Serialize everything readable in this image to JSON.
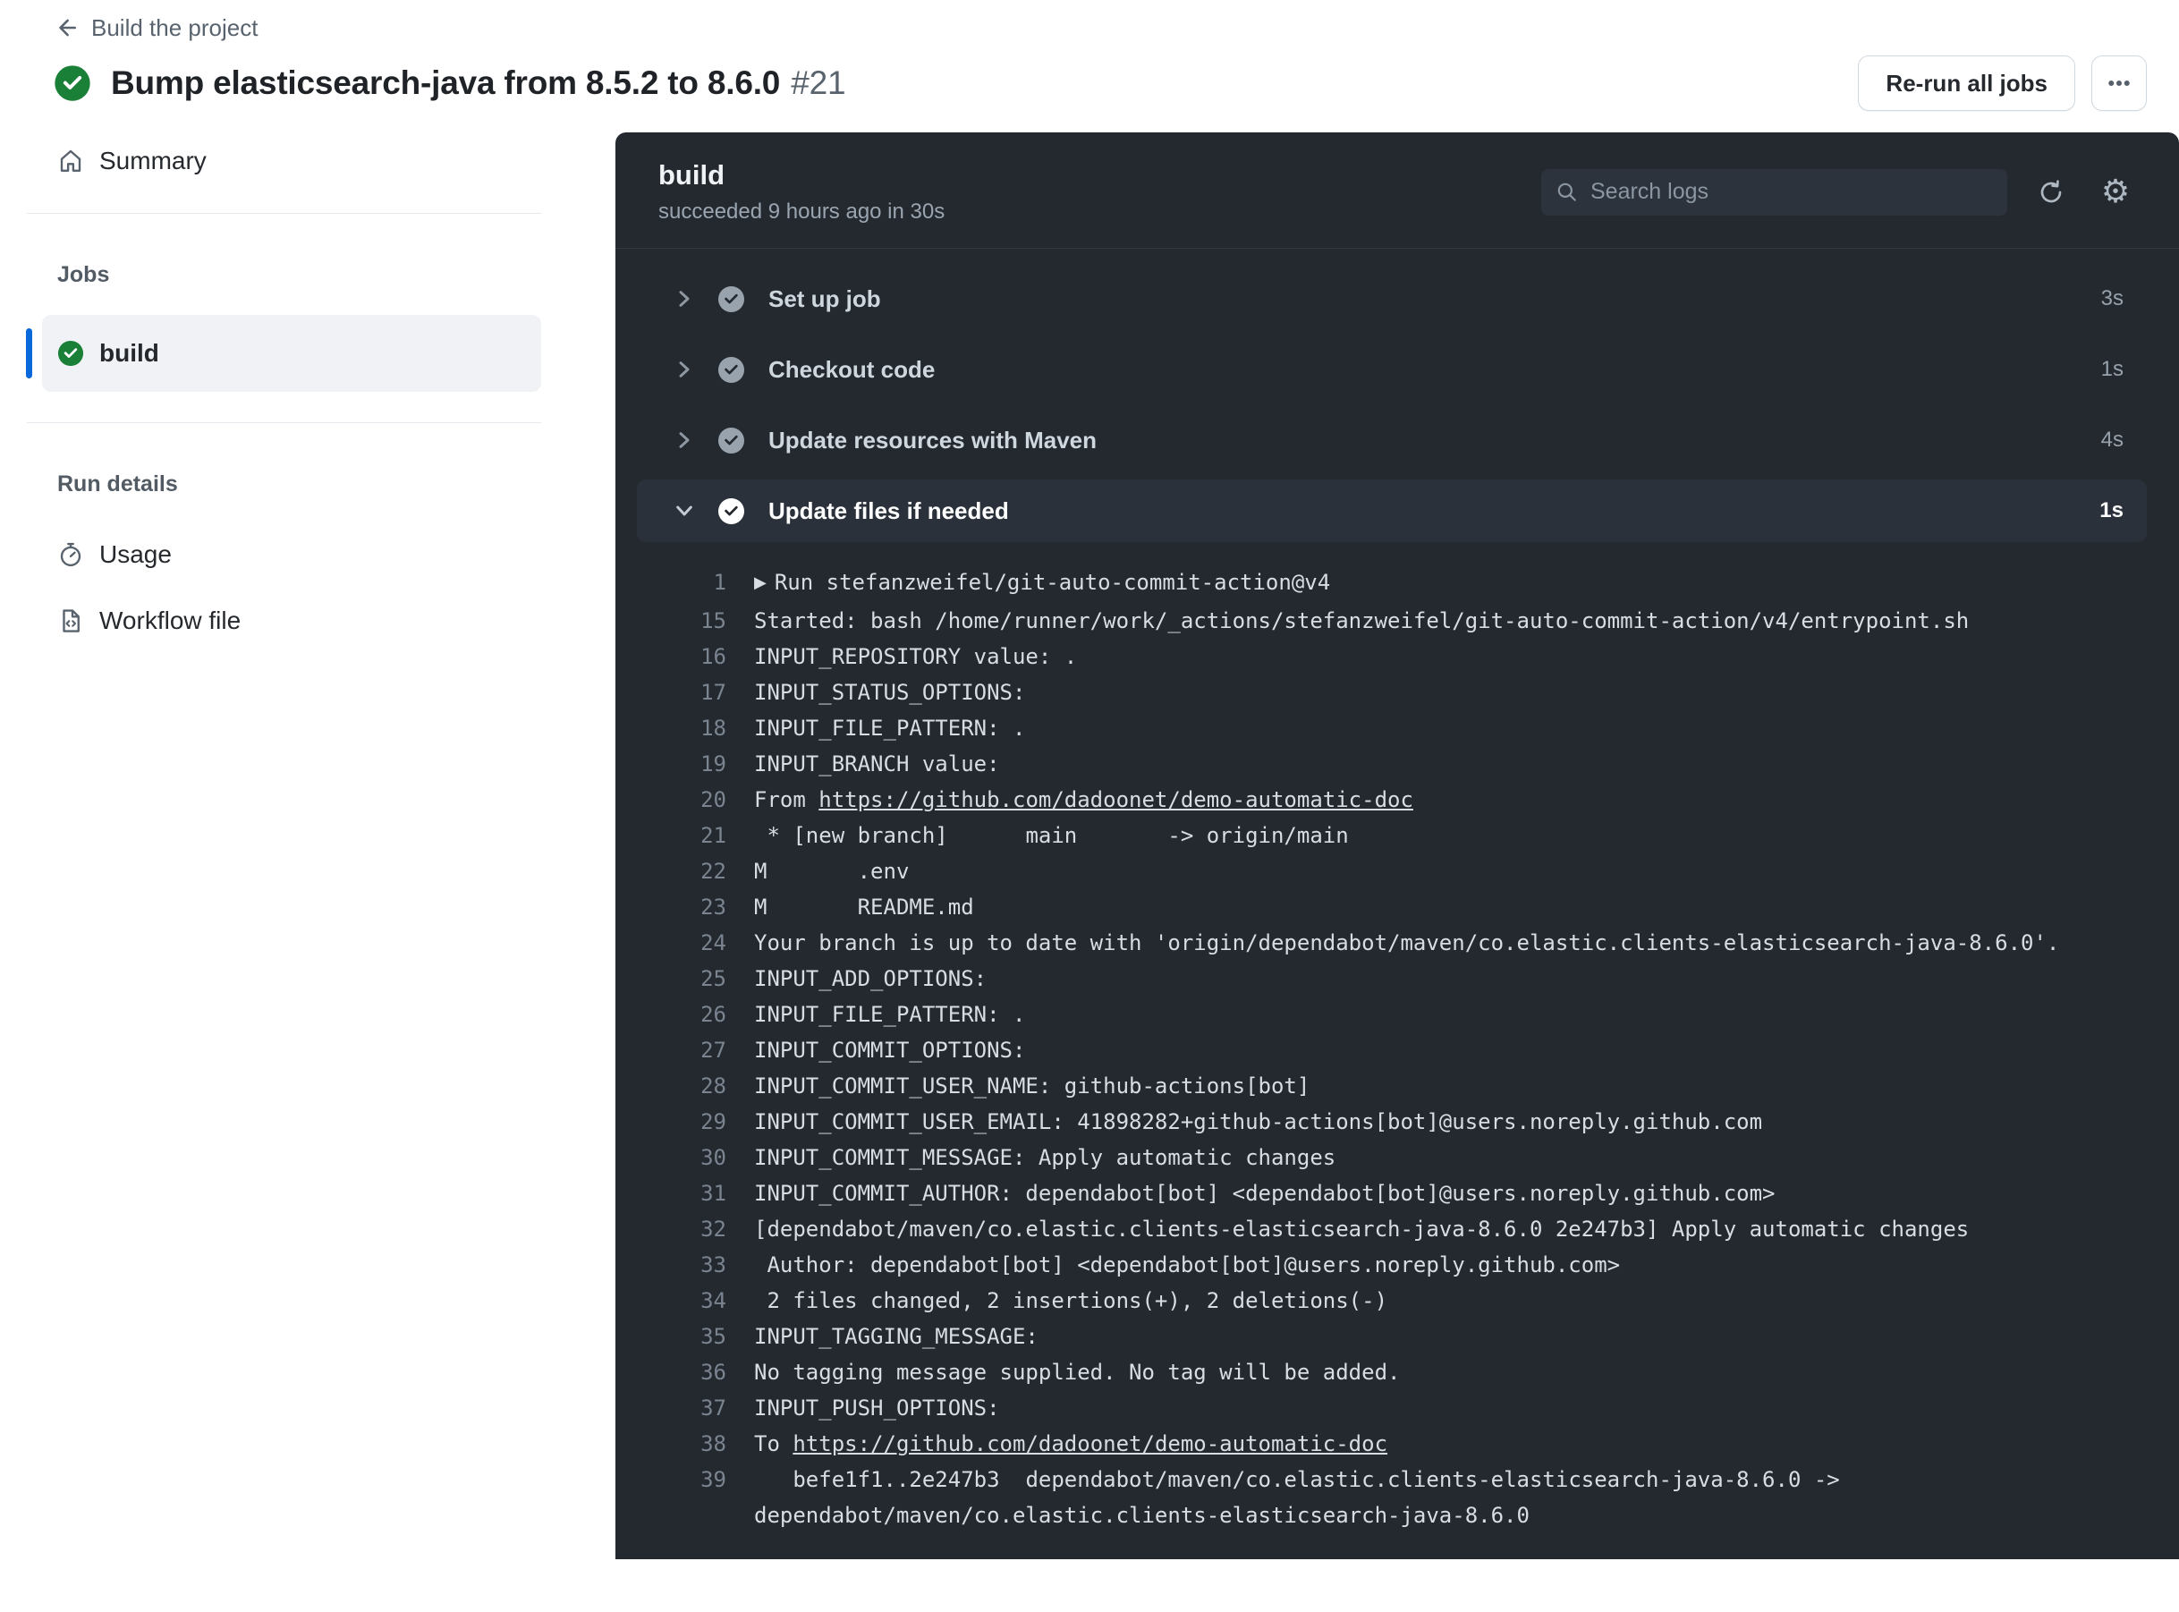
{
  "page": {
    "breadcrumb": "Build the project",
    "title": "Bump elasticsearch-java from 8.5.2 to 8.6.0",
    "run_number": "#21",
    "rerun_button": "Re-run all jobs",
    "kebab_menu": "more-options"
  },
  "sidebar": {
    "summary_label": "Summary",
    "jobs_heading": "Jobs",
    "job_name": "build",
    "run_details_heading": "Run details",
    "usage_label": "Usage",
    "workflow_file_label": "Workflow file"
  },
  "panel": {
    "job_name": "build",
    "status_line": "succeeded 9 hours ago in 30s",
    "search_placeholder": "Search logs",
    "steps": [
      {
        "label": "Set up job",
        "duration": "3s",
        "expanded": false
      },
      {
        "label": "Checkout code",
        "duration": "1s",
        "expanded": false
      },
      {
        "label": "Update resources with Maven",
        "duration": "4s",
        "expanded": false
      },
      {
        "label": "Update files if needed",
        "duration": "1s",
        "expanded": true
      }
    ],
    "log_lines": [
      {
        "n": "1",
        "prefix": "▶",
        "text": "Run stefanzweifel/git-auto-commit-action@v4"
      },
      {
        "n": "15",
        "text": "Started: bash /home/runner/work/_actions/stefanzweifel/git-auto-commit-action/v4/entrypoint.sh"
      },
      {
        "n": "16",
        "text": "INPUT_REPOSITORY value: ."
      },
      {
        "n": "17",
        "text": "INPUT_STATUS_OPTIONS:"
      },
      {
        "n": "18",
        "text": "INPUT_FILE_PATTERN: ."
      },
      {
        "n": "19",
        "text": "INPUT_BRANCH value:"
      },
      {
        "n": "20",
        "pre": "From ",
        "link": "https://github.com/dadoonet/demo-automatic-doc",
        "post": ""
      },
      {
        "n": "21",
        "text": " * [new branch]      main       -> origin/main"
      },
      {
        "n": "22",
        "text": "M       .env"
      },
      {
        "n": "23",
        "text": "M       README.md"
      },
      {
        "n": "24",
        "text": "Your branch is up to date with 'origin/dependabot/maven/co.elastic.clients-elasticsearch-java-8.6.0'."
      },
      {
        "n": "25",
        "text": "INPUT_ADD_OPTIONS:"
      },
      {
        "n": "26",
        "text": "INPUT_FILE_PATTERN: ."
      },
      {
        "n": "27",
        "text": "INPUT_COMMIT_OPTIONS:"
      },
      {
        "n": "28",
        "text": "INPUT_COMMIT_USER_NAME: github-actions[bot]"
      },
      {
        "n": "29",
        "text": "INPUT_COMMIT_USER_EMAIL: 41898282+github-actions[bot]@users.noreply.github.com"
      },
      {
        "n": "30",
        "text": "INPUT_COMMIT_MESSAGE: Apply automatic changes"
      },
      {
        "n": "31",
        "text": "INPUT_COMMIT_AUTHOR: dependabot[bot] <dependabot[bot]@users.noreply.github.com>"
      },
      {
        "n": "32",
        "text": "[dependabot/maven/co.elastic.clients-elasticsearch-java-8.6.0 2e247b3] Apply automatic changes"
      },
      {
        "n": "33",
        "text": " Author: dependabot[bot] <dependabot[bot]@users.noreply.github.com>"
      },
      {
        "n": "34",
        "text": " 2 files changed, 2 insertions(+), 2 deletions(-)"
      },
      {
        "n": "35",
        "text": "INPUT_TAGGING_MESSAGE:"
      },
      {
        "n": "36",
        "text": "No tagging message supplied. No tag will be added."
      },
      {
        "n": "37",
        "text": "INPUT_PUSH_OPTIONS:"
      },
      {
        "n": "38",
        "pre": "To ",
        "link": "https://github.com/dadoonet/demo-automatic-doc",
        "post": ""
      },
      {
        "n": "39",
        "text": "   befe1f1..2e247b3  dependabot/maven/co.elastic.clients-elasticsearch-java-8.6.0 ->"
      },
      {
        "n": "",
        "text": "dependabot/maven/co.elastic.clients-elasticsearch-java-8.6.0"
      }
    ]
  },
  "colors": {
    "success_green": "#1a7f37",
    "accent_blue": "#0969da",
    "panel_background": "#24292f",
    "expanded_row_background": "#2b313a"
  }
}
